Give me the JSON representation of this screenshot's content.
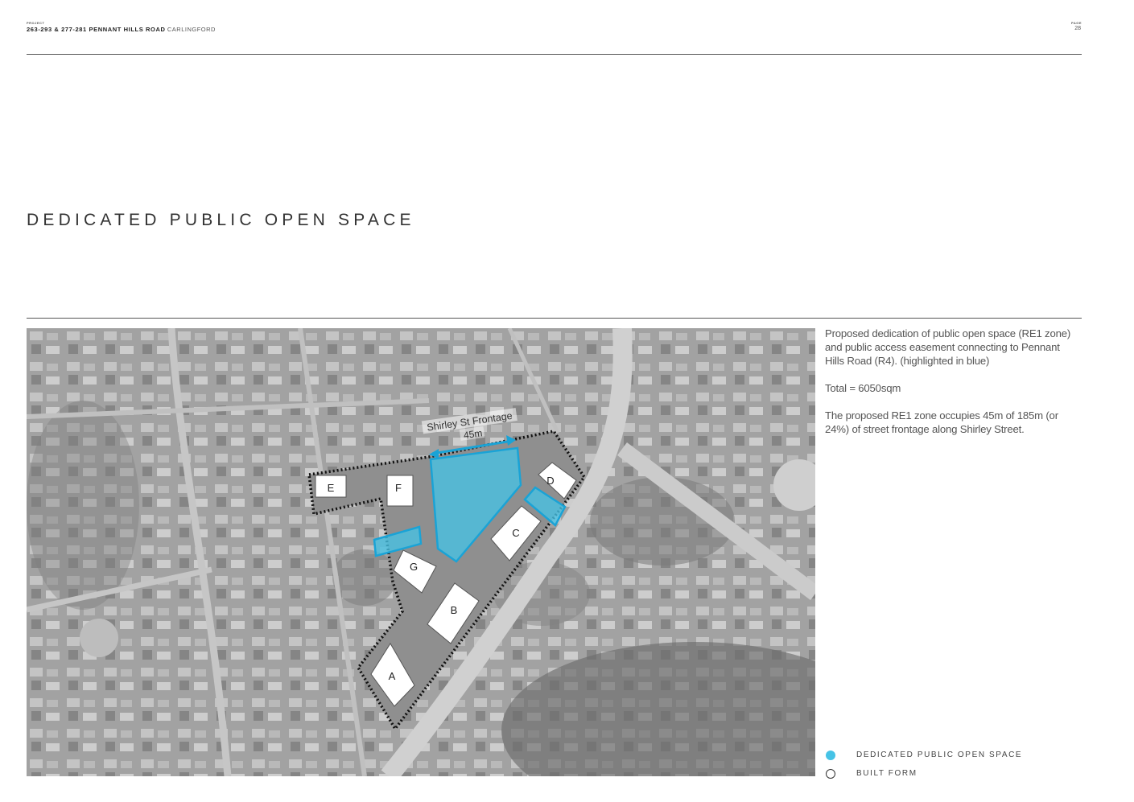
{
  "header": {
    "project_label": "PROJECT",
    "project_name": "263-293 & 277-281 PENNANT HILLS ROAD",
    "project_location": "CARLINGFORD",
    "page_label": "PAGE",
    "page_number": "28"
  },
  "title": "DEDICATED PUBLIC OPEN SPACE",
  "map": {
    "frontage_label": "Shirley St Frontage",
    "frontage_distance": "45m",
    "buildings": [
      "A",
      "B",
      "C",
      "D",
      "E",
      "F",
      "G"
    ]
  },
  "description": {
    "para1": "Proposed dedication of public open space (RE1 zone) and public access easement connecting to Pennant Hills Road (R4). (highlighted in blue)",
    "para2": "Total = 6050sqm",
    "para3": "The proposed RE1 zone occupies 45m of 185m (or 24%) of street frontage along Shirley Street."
  },
  "legend": [
    {
      "label": "DEDICATED PUBLIC OPEN SPACE",
      "color": "#46c3e6"
    },
    {
      "label": "BUILT FORM",
      "color": "#ffffff"
    }
  ],
  "colors": {
    "accent": "#46c3e6",
    "outline": "#1aa3d6"
  }
}
